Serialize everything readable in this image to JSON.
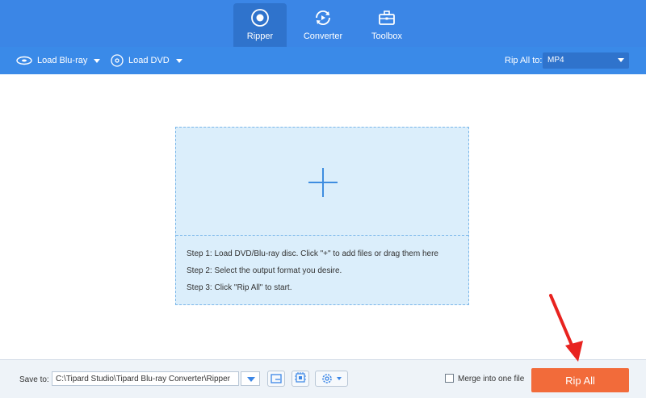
{
  "nav": {
    "tabs": [
      {
        "label": "Ripper",
        "active": true
      },
      {
        "label": "Converter",
        "active": false
      },
      {
        "label": "Toolbox",
        "active": false
      }
    ]
  },
  "toolbar": {
    "load_bluray": "Load Blu-ray",
    "load_dvd": "Load DVD",
    "rip_all_to_label": "Rip All to:",
    "format_value": "MP4"
  },
  "dropzone": {
    "steps": [
      "Step 1: Load DVD/Blu-ray disc. Click \"+\" to add files or drag them here",
      "Step 2: Select the output format you desire.",
      "Step 3: Click \"Rip All\" to start."
    ]
  },
  "footer": {
    "save_to_label": "Save to:",
    "save_path": "C:\\Tipard Studio\\Tipard Blu-ray Converter\\Ripper",
    "merge_label": "Merge into one file",
    "merge_checked": false,
    "rip_all_label": "Rip All"
  },
  "colors": {
    "nav_bg": "#3b86e6",
    "active_tab": "#2f73cc",
    "dropzone_bg": "#dbeefb",
    "rip_button": "#f26b3a",
    "annotation_arrow": "#e8231f"
  }
}
